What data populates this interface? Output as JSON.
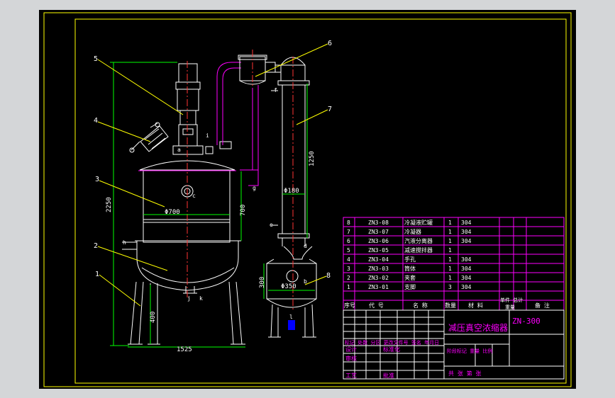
{
  "colors": {
    "background": "#d4d6d8",
    "sheet": "#000000",
    "border": "#ffff00",
    "outline": "#ffffff",
    "leader": "#ffff00",
    "dimension": "#00ff00",
    "table": "#ff00ff",
    "centerline": "#ff3333",
    "pipe": "#ff00ff",
    "bottom_valve": "#0000ff"
  },
  "dimensions": {
    "overall_height": "2250",
    "column_height": "1250",
    "vessel_dia": "Φ700",
    "vessel_h": "700",
    "leg_h": "400",
    "width": "1525",
    "column_dia": "Φ180",
    "tank_dia": "Φ350",
    "tank_h": "300"
  },
  "balloons": [
    "1",
    "2",
    "3",
    "4",
    "5",
    "6",
    "7",
    "8"
  ],
  "nozzles": {
    "a": "a",
    "b": "b",
    "c": "c",
    "d": "d",
    "e": "e",
    "f": "f",
    "g": "g",
    "h": "h",
    "i": "i",
    "j": "j",
    "k": "k",
    "l": "l"
  },
  "parts": [
    {
      "no": "8",
      "code": "ZN3-08",
      "name": "冷凝液贮罐",
      "qty": "1",
      "mat": "304"
    },
    {
      "no": "7",
      "code": "ZN3-07",
      "name": "冷凝器",
      "qty": "1",
      "mat": "304"
    },
    {
      "no": "6",
      "code": "ZN3-06",
      "name": "汽液分离器",
      "qty": "1",
      "mat": "304"
    },
    {
      "no": "5",
      "code": "ZN3-05",
      "name": "减速搅拌器",
      "qty": "1",
      "mat": ""
    },
    {
      "no": "4",
      "code": "ZN3-04",
      "name": "手孔",
      "qty": "1",
      "mat": "304"
    },
    {
      "no": "3",
      "code": "ZN3-03",
      "name": "筒体",
      "qty": "1",
      "mat": "304"
    },
    {
      "no": "2",
      "code": "ZN3-02",
      "name": "夹套",
      "qty": "1",
      "mat": "304"
    },
    {
      "no": "1",
      "code": "ZN3-01",
      "name": "支脚",
      "qty": "3",
      "mat": "304"
    }
  ],
  "header": {
    "no": "序号",
    "code": "代  号",
    "name": "名  称",
    "qty": "数量",
    "mat": "材  料",
    "weight_line1": "单件 总计",
    "weight_line2": "重量",
    "remark": "备  注"
  },
  "title_block": {
    "title": "减压真空浓缩器",
    "model": "ZN-300",
    "revision_row": "标记 处数 分区 更改文件号 签名 年月日",
    "design": "设计",
    "standardize": "标准化",
    "review": "审核",
    "process": "工艺",
    "approve": "批准",
    "stage_row": "阶段标记  重量  比例",
    "sheets_row": "共  张    第  张"
  }
}
